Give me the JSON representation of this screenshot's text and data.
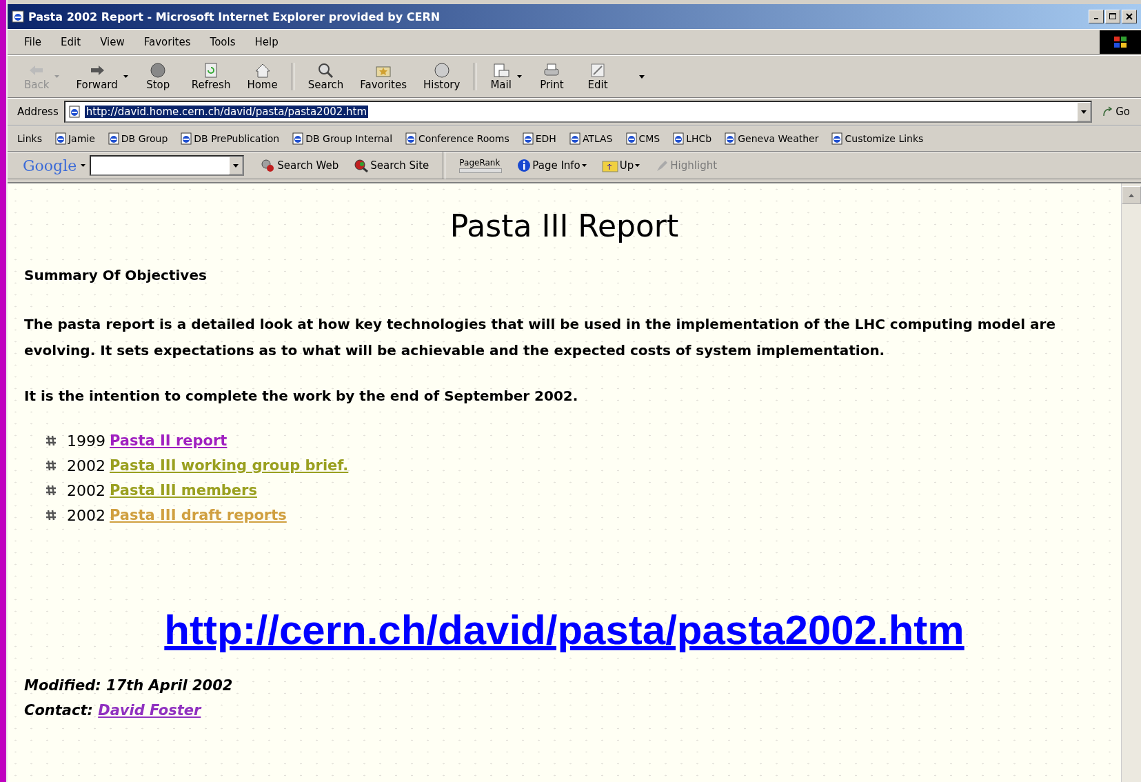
{
  "window": {
    "title": "Pasta 2002 Report - Microsoft Internet Explorer provided by CERN"
  },
  "menu": [
    "File",
    "Edit",
    "View",
    "Favorites",
    "Tools",
    "Help"
  ],
  "toolbar": [
    {
      "label": "Back",
      "disabled": true,
      "dropdown": true
    },
    {
      "label": "Forward",
      "disabled": false,
      "dropdown": true
    },
    {
      "label": "Stop",
      "disabled": false,
      "dropdown": false
    },
    {
      "label": "Refresh",
      "disabled": false,
      "dropdown": false
    },
    {
      "label": "Home",
      "disabled": false,
      "dropdown": false
    },
    {
      "label": "Search",
      "disabled": false,
      "dropdown": false
    },
    {
      "label": "Favorites",
      "disabled": false,
      "dropdown": false
    },
    {
      "label": "History",
      "disabled": false,
      "dropdown": false
    },
    {
      "label": "Mail",
      "disabled": false,
      "dropdown": true
    },
    {
      "label": "Print",
      "disabled": false,
      "dropdown": false
    },
    {
      "label": "Edit",
      "disabled": false,
      "dropdown": false
    }
  ],
  "address": {
    "label": "Address",
    "value": "http://david.home.cern.ch/david/pasta/pasta2002.htm",
    "go": "Go"
  },
  "links": {
    "label": "Links",
    "items": [
      "Jamie",
      "DB Group",
      "DB PrePublication",
      "DB Group Internal",
      "Conference Rooms",
      "EDH",
      "ATLAS",
      "CMS",
      "LHCb",
      "Geneva Weather",
      "Customize Links"
    ]
  },
  "google_bar": {
    "logo": "Google",
    "items": [
      {
        "label": "Search Web",
        "disabled": false,
        "dropdown": false
      },
      {
        "label": "Search Site",
        "disabled": false,
        "dropdown": false
      },
      {
        "label": "PageRank",
        "disabled": false,
        "dropdown": false
      },
      {
        "label": "Page Info",
        "disabled": false,
        "dropdown": true
      },
      {
        "label": "Up",
        "disabled": false,
        "dropdown": true
      },
      {
        "label": "Highlight",
        "disabled": true,
        "dropdown": false
      }
    ]
  },
  "page": {
    "title": "Pasta III Report",
    "heading": "Summary Of Objectives",
    "paragraphs": [
      "The pasta report is a detailed look at how key technologies that will be used in the implementation of the LHC computing model are evolving. It sets expectations as to what will be achievable and the expected costs of system implementation.",
      "It is the intention to complete the work by the end of September 2002."
    ],
    "items": [
      {
        "year": "1999",
        "link": "Pasta II report",
        "color": "#a020c0"
      },
      {
        "year": "2002",
        "link": "Pasta III working group brief.",
        "color": "#9aa020"
      },
      {
        "year": "2002",
        "link": "Pasta III members",
        "color": "#9aa020"
      },
      {
        "year": "2002",
        "link": "Pasta III draft reports",
        "color": "#d0a040"
      }
    ],
    "overlay_link": "http://cern.ch/david/pasta/pasta2002.htm",
    "modified": "Modified: 17th April 2002",
    "contact_label": "Contact:",
    "contact_link": "David Foster"
  }
}
